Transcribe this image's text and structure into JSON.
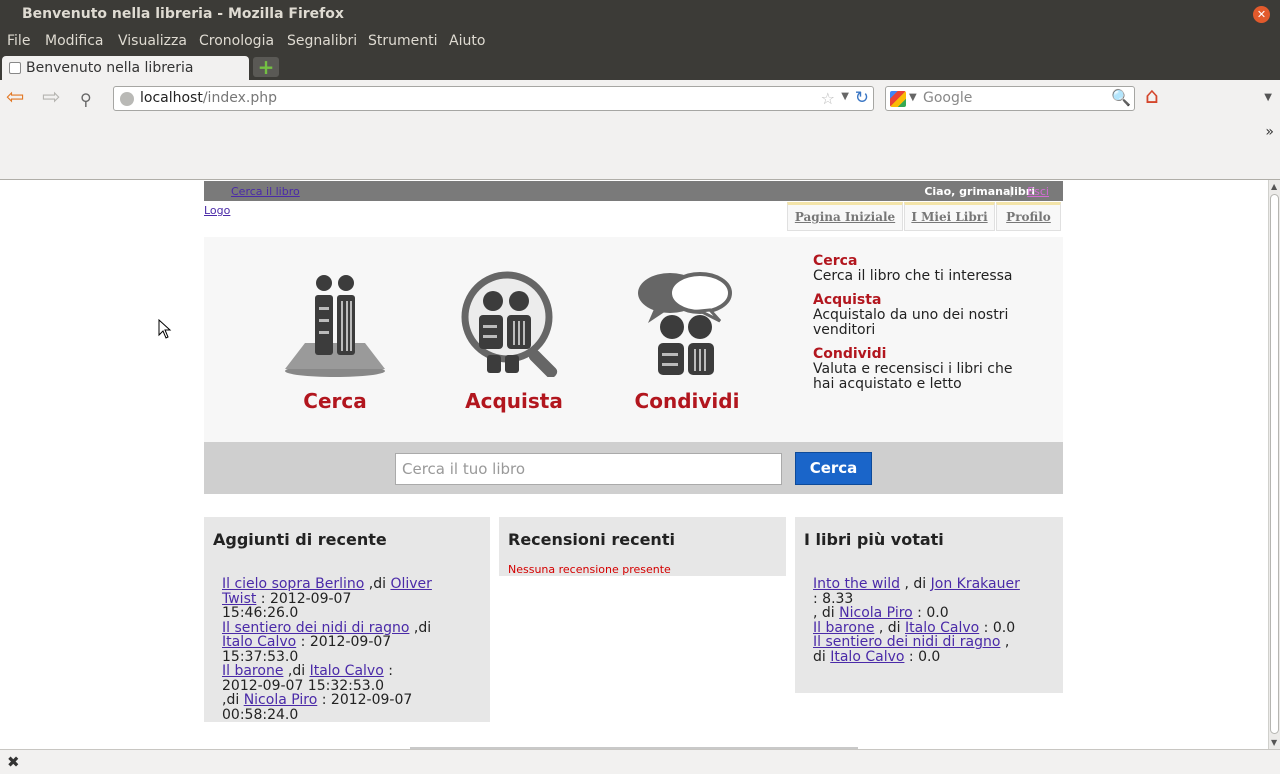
{
  "window": {
    "title": "Benvenuto nella libreria - Mozilla Firefox"
  },
  "menu": [
    "File",
    "Modifica",
    "Visualizza",
    "Cronologia",
    "Segnalibri",
    "Strumenti",
    "Aiuto"
  ],
  "tab": {
    "label": "Benvenuto nella libreria"
  },
  "urlbar": {
    "host": "localhost",
    "path": "/index.php"
  },
  "searchbar": {
    "placeholder": "Google"
  },
  "top": {
    "find_link": "Cerca il libro",
    "greeting": "Ciao, grimanalibri",
    "separator": "|",
    "logout": "Esci"
  },
  "logo": "Logo",
  "pagetabs": [
    "Pagina Iniziale",
    "I Miei Libri",
    "Profilo"
  ],
  "features": [
    {
      "caption": "Cerca",
      "icon": "books-pedestal-icon"
    },
    {
      "caption": "Acquista",
      "icon": "magnifier-people-icon"
    },
    {
      "caption": "Condividi",
      "icon": "speech-people-icon"
    }
  ],
  "side": [
    {
      "title": "Cerca",
      "text": "Cerca il libro che ti interessa"
    },
    {
      "title": "Acquista",
      "text": "Acquistalo da uno dei nostri venditori"
    },
    {
      "title": "Condividi",
      "text": "Valuta e recensisci i libri che hai acquistato e letto"
    }
  ],
  "search": {
    "placeholder": "Cerca il tuo libro",
    "button": "Cerca"
  },
  "recent": {
    "title": "Aggiunti di recente",
    "items": [
      {
        "book": "Il cielo sopra Berlino",
        "author": "Oliver Twist",
        "date": "2012-09-07 15:46:26.0"
      },
      {
        "book": "Il sentiero dei nidi di ragno",
        "author": "Italo Calvo",
        "date": "2012-09-07 15:37:53.0"
      },
      {
        "book": "Il barone",
        "author": "Italo Calvo",
        "date": "2012-09-07 15:32:53.0"
      },
      {
        "book": "",
        "author": "Nicola Piro",
        "date": "2012-09-07 00:58:24.0"
      }
    ]
  },
  "reviews": {
    "title": "Recensioni recenti",
    "empty": "Nessuna recensione presente"
  },
  "top_rated": {
    "title": "I libri più votati",
    "items": [
      {
        "book": "Into the wild",
        "author": "Jon Krakauer",
        "score": "8.33"
      },
      {
        "book": "",
        "author": "Nicola Piro",
        "score": "0.0"
      },
      {
        "book": "Il barone",
        "author": "Italo Calvo",
        "score": "0.0"
      },
      {
        "book": "Il sentiero dei nidi di ragno",
        "author": "Italo Calvo",
        "score": "0.0"
      }
    ]
  },
  "colors": {
    "accent_red": "#b2161e",
    "button_blue": "#1a65c9",
    "link_purple": "#4a2aa8"
  }
}
